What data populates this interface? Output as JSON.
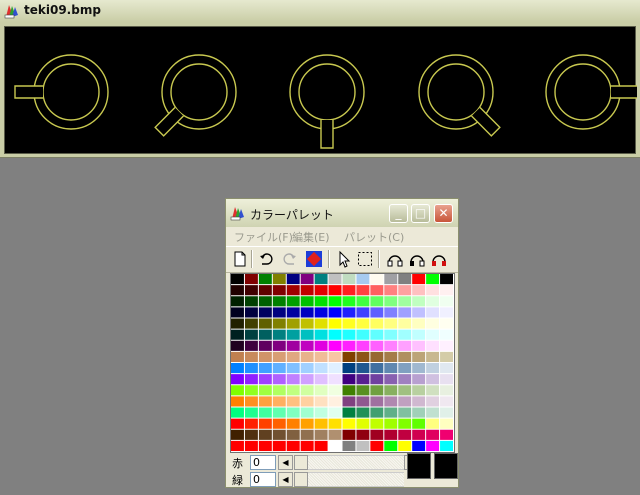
{
  "image_window": {
    "title": "teki09.bmp",
    "icon": "paint-palette-icon"
  },
  "palette_window": {
    "title": "カラーパレット",
    "icon": "paint-palette-icon",
    "caption_buttons": [
      "minimize",
      "maximize",
      "close"
    ],
    "menu": [
      "ファイル(F)",
      "編集(E)",
      "パレット(C)"
    ],
    "toolbar": [
      "new-icon",
      "undo-icon",
      "redo-icon",
      "swap-color-icon",
      "pointer-icon",
      "select-rect-icon",
      "gradient-1-icon",
      "gradient-2-icon",
      "gradient-3-icon"
    ],
    "controls": [
      {
        "label": "赤",
        "value": "0"
      },
      {
        "label": "緑",
        "value": "0"
      }
    ]
  },
  "colors": {
    "sprite": "#c8c850",
    "canvas_bg": "#000000",
    "desktop": "#808080"
  },
  "palette_rows": [
    [
      "#000000",
      "#800000",
      "#008000",
      "#808000",
      "#000080",
      "#800080",
      "#008080",
      "#c0c0c0",
      "#c0dcc0",
      "#a6caf0",
      "#fffbf0",
      "#a0a0a4",
      "#808080",
      "#ff0000",
      "#00ff00",
      "#000000"
    ],
    [
      "#200000",
      "#400000",
      "#600000",
      "#800000",
      "#a00000",
      "#c00000",
      "#e00000",
      "#ff0000",
      "#ff2020",
      "#ff4040",
      "#ff6060",
      "#ff8080",
      "#ffa0a0",
      "#ffc0c0",
      "#ffe0e0",
      "#fff0f0"
    ],
    [
      "#002000",
      "#004000",
      "#006000",
      "#008000",
      "#00a000",
      "#00c000",
      "#00e000",
      "#00ff00",
      "#20ff20",
      "#40ff40",
      "#60ff60",
      "#80ff80",
      "#a0ffa0",
      "#c0ffc0",
      "#e0ffe0",
      "#f0fff0"
    ],
    [
      "#000020",
      "#000040",
      "#000060",
      "#000080",
      "#0000a0",
      "#0000c0",
      "#0000e0",
      "#0000ff",
      "#2020ff",
      "#4040ff",
      "#6060ff",
      "#8080ff",
      "#a0a0ff",
      "#c0c0ff",
      "#e0e0ff",
      "#f0f0ff"
    ],
    [
      "#202000",
      "#404000",
      "#606000",
      "#808000",
      "#a0a000",
      "#c0c000",
      "#e0e000",
      "#ffff00",
      "#ffff20",
      "#ffff40",
      "#ffff60",
      "#ffff80",
      "#ffffa0",
      "#ffffc0",
      "#ffffe0",
      "#fffff0"
    ],
    [
      "#002020",
      "#004040",
      "#006060",
      "#008080",
      "#00a0a0",
      "#00c0c0",
      "#00e0e0",
      "#00ffff",
      "#20ffff",
      "#40ffff",
      "#60ffff",
      "#80ffff",
      "#a0ffff",
      "#c0ffff",
      "#e0ffff",
      "#f0ffff"
    ],
    [
      "#200020",
      "#400040",
      "#600060",
      "#800080",
      "#a000a0",
      "#c000c0",
      "#e000e0",
      "#ff00ff",
      "#ff20ff",
      "#ff40ff",
      "#ff60ff",
      "#ff80ff",
      "#ffa0ff",
      "#ffc0ff",
      "#ffe0ff",
      "#fff0ff"
    ],
    [
      "#c08050",
      "#c88a5c",
      "#d09468",
      "#d89e74",
      "#e0a880",
      "#e8b28c",
      "#f0bc98",
      "#f8c6a4",
      "#804000",
      "#8c5418",
      "#986830",
      "#a47c48",
      "#b09060",
      "#bca478",
      "#c8b890",
      "#d4cca8"
    ],
    [
      "#0080ff",
      "#2090ff",
      "#40a0ff",
      "#60b0ff",
      "#80c0ff",
      "#a0d0ff",
      "#c0e0ff",
      "#e0f0ff",
      "#004080",
      "#205890",
      "#4070a0",
      "#6088b0",
      "#80a0c0",
      "#a0b8d0",
      "#c0d0e0",
      "#e0e8f0"
    ],
    [
      "#8000ff",
      "#9020ff",
      "#a040ff",
      "#b060ff",
      "#c080ff",
      "#d0a0ff",
      "#e0c0ff",
      "#f0e0ff",
      "#400080",
      "#582090",
      "#7040a0",
      "#8860b0",
      "#a080c0",
      "#b8a0d0",
      "#d0c0e0",
      "#e8e0f0"
    ],
    [
      "#80ff00",
      "#90ff20",
      "#a0ff40",
      "#b0ff60",
      "#c0ff80",
      "#d0ffa0",
      "#e0ffc0",
      "#f0ffe0",
      "#408000",
      "#589020",
      "#70a040",
      "#88b060",
      "#a0c080",
      "#b8d0a0",
      "#d0e0c0",
      "#e8f0e0"
    ],
    [
      "#ff8000",
      "#ff9020",
      "#ffa040",
      "#ffb060",
      "#ffc080",
      "#ffd0a0",
      "#ffe0c0",
      "#fff0e0",
      "#804080",
      "#905890",
      "#a070a0",
      "#b088b0",
      "#c0a0c0",
      "#d0b8d0",
      "#e0d0e0",
      "#f0e8f0"
    ],
    [
      "#00ff80",
      "#20ff90",
      "#40ffa0",
      "#60ffb0",
      "#80ffc0",
      "#a0ffd0",
      "#c0ffe0",
      "#e0fff0",
      "#008040",
      "#209058",
      "#40a070",
      "#60b088",
      "#80c0a0",
      "#a0d0b8",
      "#c0e0d0",
      "#e0f0e8"
    ],
    [
      "#ff0000",
      "#ff2000",
      "#ff4000",
      "#ff6000",
      "#ff8000",
      "#ffa000",
      "#ffc000",
      "#ffe000",
      "#ffff00",
      "#e0ff00",
      "#c0ff00",
      "#a0ff00",
      "#80ff00",
      "#60ff00",
      "#ffff80",
      "#ffffc0"
    ],
    [
      "#402000",
      "#503010",
      "#604020",
      "#705030",
      "#806040",
      "#907050",
      "#a08060",
      "#b09070",
      "#800000",
      "#900010",
      "#a00020",
      "#b00030",
      "#c00040",
      "#d00050",
      "#e00060",
      "#f00070"
    ],
    [
      "#ff0000",
      "#ff0000",
      "#ff0000",
      "#ff0000",
      "#ff0000",
      "#ff0000",
      "#ff0000",
      "#ffffff",
      "#808080",
      "#c0c0c0",
      "#ff0000",
      "#00ff00",
      "#ffff00",
      "#0000ff",
      "#ff00ff",
      "#00ffff"
    ]
  ]
}
